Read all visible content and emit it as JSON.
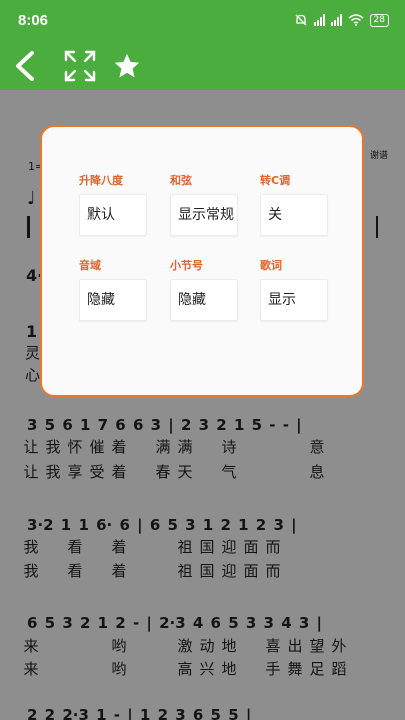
{
  "status_bar": {
    "time": "8:06",
    "battery": "28"
  },
  "toolbar": {
    "back_icon": "back-arrow-icon",
    "fullscreen_icon": "fullscreen-icon",
    "favorite_icon": "star-icon"
  },
  "colors": {
    "header_green": "#4cad3f",
    "dialog_border": "#e8772c",
    "label_orange": "#e2622a",
    "score_bg": "#8e8e8e"
  },
  "settings_dialog": {
    "options": [
      {
        "label": "升降八度",
        "value": "默认"
      },
      {
        "label": "和弦",
        "value": "显示常规"
      },
      {
        "label": "转C调",
        "value": "关"
      },
      {
        "label": "音域",
        "value": "隐藏"
      },
      {
        "label": "小节号",
        "value": "隐藏"
      },
      {
        "label": "歌词",
        "value": "显示"
      }
    ]
  },
  "score": {
    "partial_text": {
      "top_right": "谢谱",
      "bar_number": "1=",
      "row_start": "4·",
      "partial_one": "1",
      "partial_lyric_1": "灵",
      "partial_lyric_2": "心"
    },
    "lines": [
      {
        "notes": "3 5  6 1  7 6  6 3  | 2 3 2 1  5  -  -  |",
        "lyrics_1": [
          "让",
          "我",
          "怀",
          "催",
          "着",
          "",
          "满",
          "满",
          "",
          "诗",
          "",
          "",
          "",
          "意"
        ],
        "lyrics_2": [
          "让",
          "我",
          "享",
          "受",
          "着",
          "",
          "春",
          "天",
          "",
          "气",
          "",
          "",
          "",
          "息"
        ]
      },
      {
        "notes": "3·2  1 1  6· 6  |  6 5  3 1  2 1 2  3  |",
        "lyrics_1": [
          "我",
          "",
          "看",
          "",
          "着",
          "",
          "",
          "祖",
          "国",
          "迎",
          "面",
          "而"
        ],
        "lyrics_2": [
          "我",
          "",
          "看",
          "",
          "着",
          "",
          "",
          "祖",
          "国",
          "迎",
          "面",
          "而"
        ]
      },
      {
        "notes": "6 5  3 2 1  2  -  |  2·3  4 6  5 3  3 4 3  |",
        "lyrics_1": [
          "来",
          "",
          "",
          "",
          "哟",
          "",
          "",
          "激",
          "动",
          "地",
          "",
          "喜",
          "出",
          "望",
          "外"
        ],
        "lyrics_2": [
          "来",
          "",
          "",
          "",
          "哟",
          "",
          "",
          "高",
          "兴",
          "地",
          "",
          "手",
          "舞",
          "足",
          "蹈"
        ]
      },
      {
        "notes": "2 2  2·3  1  -  |  1 2  3 6  5 5  |"
      }
    ]
  }
}
